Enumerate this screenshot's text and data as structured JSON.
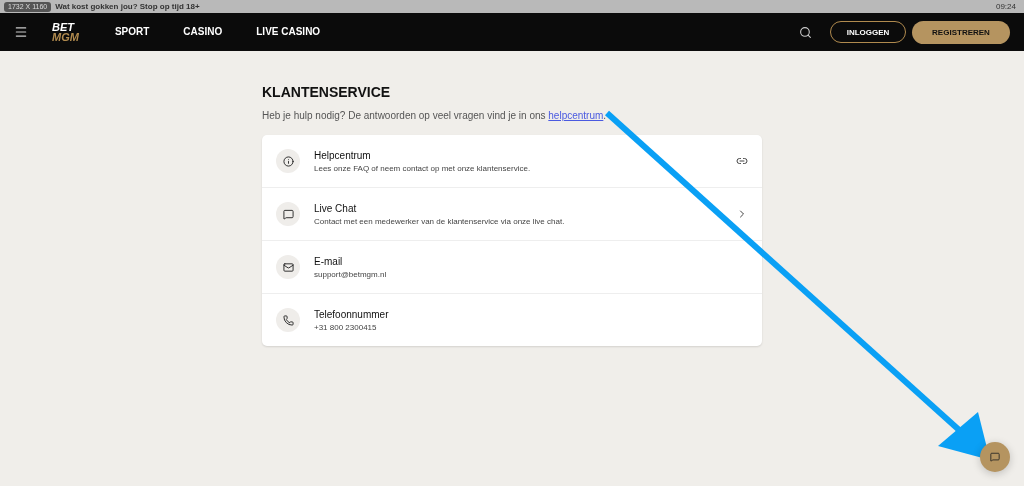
{
  "screen_badge": "1732 X 1160",
  "banner": {
    "text": "Wat kost gokken jou? Stop op tijd 18+",
    "time": "09:24"
  },
  "nav": {
    "links": [
      {
        "label": "SPORT",
        "selected": false
      },
      {
        "label": "CASINO",
        "selected": false
      },
      {
        "label": "LIVE CASINO",
        "selected": false
      }
    ],
    "logo": [
      "BET",
      "MGM"
    ],
    "login": "INLOGGEN",
    "register": "REGISTREREN"
  },
  "page": {
    "title": "KLANTENSERVICE",
    "intro": "Heb je hulp nodig? De antwoorden op veel vragen vind je in ons ",
    "intro_link": "helpcentrum",
    "intro_end": "."
  },
  "options": [
    {
      "kind": "info",
      "title": "Helpcentrum",
      "subtitle": "Lees onze FAQ of neem contact op met onze klantenservice.",
      "link_icon": true,
      "chevron": false
    },
    {
      "kind": "chat",
      "title": "Live Chat",
      "subtitle": "Contact met een medewerker van de klantenservice via onze live chat.",
      "link_icon": false,
      "chevron": true
    },
    {
      "kind": "mail",
      "title": "E-mail",
      "subtitle": "support@betmgm.nl",
      "link_icon": false,
      "chevron": false
    },
    {
      "kind": "phone",
      "title": "Telefoonnummer",
      "subtitle": "+31 800 2300415",
      "link_icon": false,
      "chevron": false
    }
  ]
}
